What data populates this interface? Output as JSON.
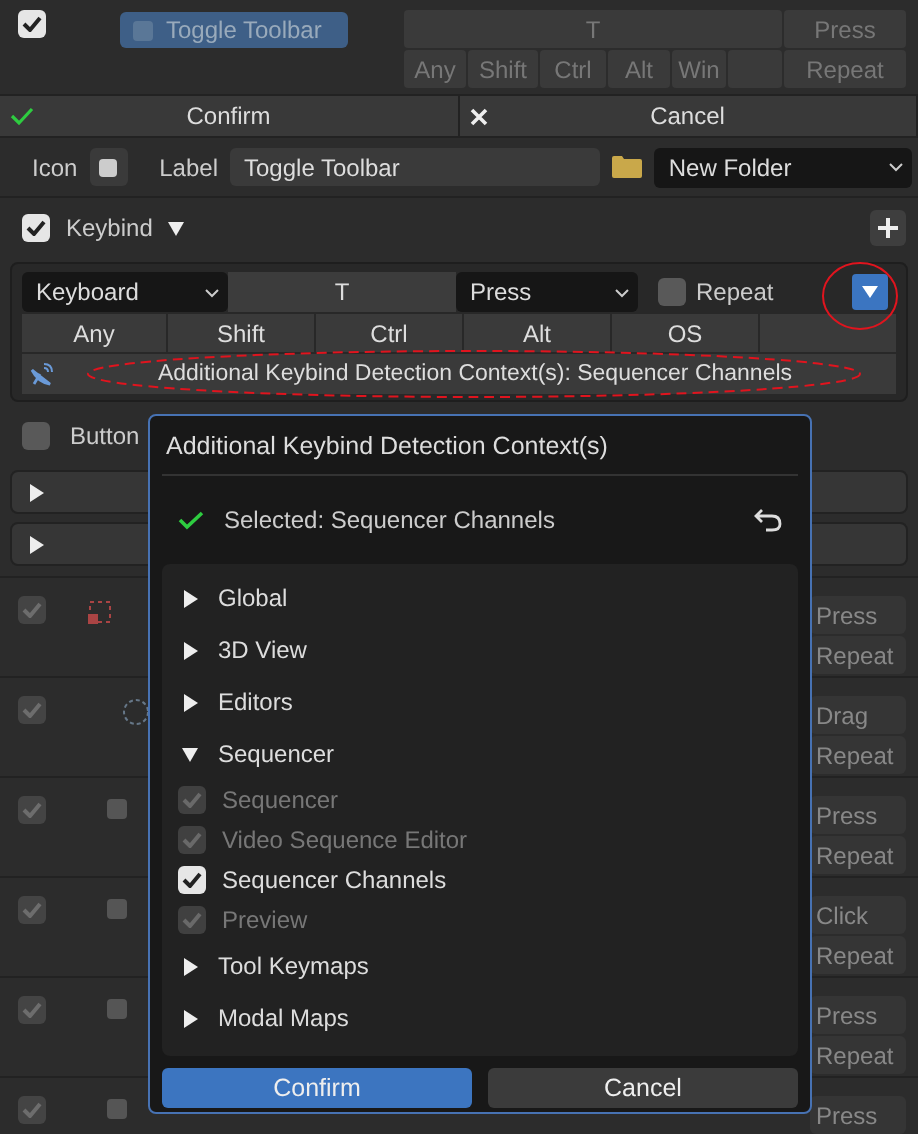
{
  "shortcut_row": {
    "checked": true,
    "name": "Toggle Toolbar",
    "key": "T",
    "event": "Press",
    "modifiers": [
      "Any",
      "Shift",
      "Ctrl",
      "Alt",
      "Win"
    ],
    "repeat": "Repeat"
  },
  "edit_bar": {
    "confirm": "Confirm",
    "cancel": "Cancel"
  },
  "icon_label": "Icon",
  "label_label": "Label",
  "label_value": "Toggle Toolbar",
  "folder": "New Folder",
  "keybind": {
    "checked": true,
    "label": "Keybind",
    "expanded": true
  },
  "keybind_panel": {
    "device": "Keyboard",
    "key": "T",
    "event": "Press",
    "repeat": {
      "label": "Repeat",
      "checked": false
    },
    "modifiers": [
      {
        "label": "Any",
        "selected": false
      },
      {
        "label": "Shift",
        "selected": false
      },
      {
        "label": "Ctrl",
        "selected": false
      },
      {
        "label": "Alt",
        "selected": false
      },
      {
        "label": "OS",
        "selected": false
      }
    ],
    "context": "Additional Keybind Detection Context(s): Sequencer Channels"
  },
  "button": {
    "label": "Button",
    "checked": false
  },
  "sections": [
    {
      "expanded": false
    },
    {
      "expanded": false
    }
  ],
  "items": [
    {
      "checked": true,
      "kind": "dotted",
      "buttons": [
        "Press",
        "Repeat"
      ]
    },
    {
      "checked": true,
      "kind": "circle",
      "buttons": [
        "Drag",
        "Repeat"
      ]
    },
    {
      "checked": true,
      "kind": "square",
      "buttons": [
        "Press",
        "Repeat"
      ]
    },
    {
      "checked": true,
      "kind": "square",
      "buttons": [
        "Click",
        "Repeat"
      ]
    },
    {
      "checked": true,
      "kind": "square",
      "buttons": [
        "Press",
        "Repeat"
      ]
    },
    {
      "checked": true,
      "kind": "square",
      "buttons": [
        "Press"
      ]
    }
  ],
  "popup": {
    "title": "Additional Keybind Detection Context(s)",
    "selected": "Selected: Sequencer Channels",
    "tree": [
      {
        "label": "Global",
        "expanded": false
      },
      {
        "label": "3D View",
        "expanded": false
      },
      {
        "label": "Editors",
        "expanded": false
      },
      {
        "label": "Sequencer",
        "expanded": true,
        "children": [
          {
            "label": "Sequencer",
            "checked": true,
            "disabled": true
          },
          {
            "label": "Video Sequence Editor",
            "checked": true,
            "disabled": true
          },
          {
            "label": "Sequencer Channels",
            "checked": true,
            "disabled": false
          },
          {
            "label": "Preview",
            "checked": true,
            "disabled": true
          }
        ]
      },
      {
        "label": "Tool Keymaps",
        "expanded": false
      },
      {
        "label": "Modal Maps",
        "expanded": false
      }
    ],
    "confirm": "Confirm",
    "cancel": "Cancel"
  }
}
